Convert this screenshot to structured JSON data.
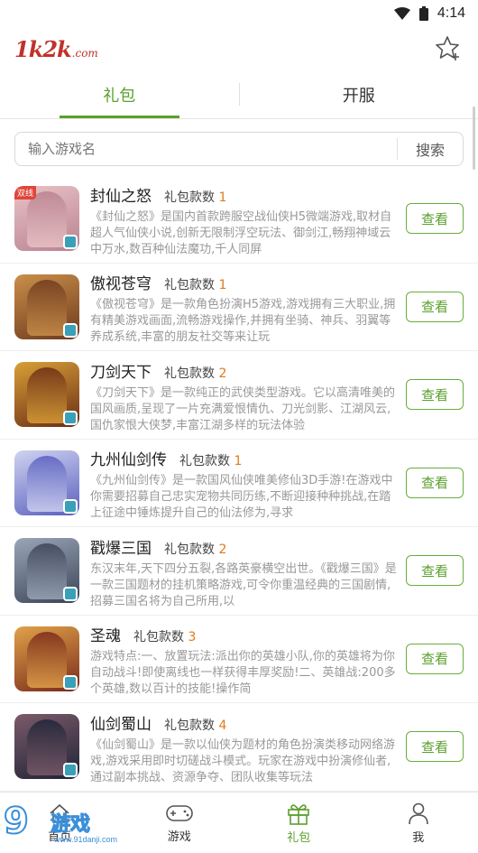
{
  "status_bar": {
    "time": "4:14"
  },
  "header": {
    "logo_main": "1k2k",
    "logo_suffix": ".com"
  },
  "tabs": [
    {
      "label": "礼包"
    },
    {
      "label": "开服"
    }
  ],
  "search": {
    "placeholder": "输入游戏名",
    "button_label": "搜索"
  },
  "games": [
    {
      "name": "封仙之怒",
      "count_label": "礼包款数",
      "count": "1",
      "icon_tag": "双线",
      "desc": "《封仙之怒》是国内首款跨服空战仙侠H5微端游戏,取材自超人气仙侠小说,创新无限制浮空玩法、御剑江,畅翔神域云中万水,数百种仙法魔功,千人同屏",
      "button": "查看",
      "colors": [
        "#e9c3c6",
        "#b98290"
      ]
    },
    {
      "name": "傲视苍穹",
      "count_label": "礼包款数",
      "count": "1",
      "icon_tag": "",
      "desc": "《傲视苍穹》是一款角色扮演H5游戏,游戏拥有三大职业,拥有精美游戏画面,流畅游戏操作,并拥有坐骑、神兵、羽翼等养成系统,丰富的朋友社交等来让玩",
      "button": "查看",
      "colors": [
        "#c98f4a",
        "#6f3a1e"
      ]
    },
    {
      "name": "刀剑天下",
      "count_label": "礼包款数",
      "count": "2",
      "icon_tag": "",
      "desc": "《刀剑天下》是一款纯正的武侠类型游戏。它以高清唯美的国风画质,呈现了一片充满爱恨情仇、刀光剑影、江湖风云,国仇家恨大侠梦,丰富江湖多样的玩法体验",
      "button": "查看",
      "colors": [
        "#d8a036",
        "#6b2d17"
      ]
    },
    {
      "name": "九州仙剑传",
      "count_label": "礼包款数",
      "count": "1",
      "icon_tag": "",
      "desc": "《九州仙剑传》是一款国风仙侠唯美修仙3D手游!在游戏中你需要招募自己忠实宠物共同历练,不断迎接种种挑战,在踏上征途中锤炼提升自己的仙法修为,寻求",
      "button": "查看",
      "colors": [
        "#cfd3f0",
        "#5a5fbf"
      ]
    },
    {
      "name": "戳爆三国",
      "count_label": "礼包款数",
      "count": "2",
      "icon_tag": "",
      "desc": "东汉末年,天下四分五裂,各路英豪横空出世。《戳爆三国》是一款三国题材的挂机策略游戏,可令你重温经典的三国剧情,招募三国名将为自己所用,以",
      "button": "查看",
      "colors": [
        "#9aa6b8",
        "#3b4456"
      ]
    },
    {
      "name": "圣魂",
      "count_label": "礼包款数",
      "count": "3",
      "icon_tag": "",
      "desc": "游戏特点:一、放置玩法:派出你的英雄小队,你的英雄将为你自动战斗!即使离线也一样获得丰厚奖励!二、英雄战:200多个英雄,数以百计的技能!操作简",
      "button": "查看",
      "colors": [
        "#e0a24a",
        "#7a2a1a"
      ]
    },
    {
      "name": "仙剑蜀山",
      "count_label": "礼包款数",
      "count": "4",
      "icon_tag": "",
      "desc": "《仙剑蜀山》是一款以仙侠为题材的角色扮演类移动网络游戏,游戏采用即时切磋战斗模式。玩家在游戏中扮演修仙者,通过副本挑战、资源争夺、团队收集等玩法",
      "button": "查看",
      "colors": [
        "#7c5a6a",
        "#1e2436"
      ]
    }
  ],
  "bottom_nav": [
    {
      "label": "首页"
    },
    {
      "label": "游戏"
    },
    {
      "label": "礼包"
    },
    {
      "label": "我"
    }
  ],
  "watermark": {
    "big": "9",
    "cn": "游戏",
    "url": "www.91danji.com"
  },
  "accent_color": "#5aa02c",
  "count_color": "#e07a1a"
}
